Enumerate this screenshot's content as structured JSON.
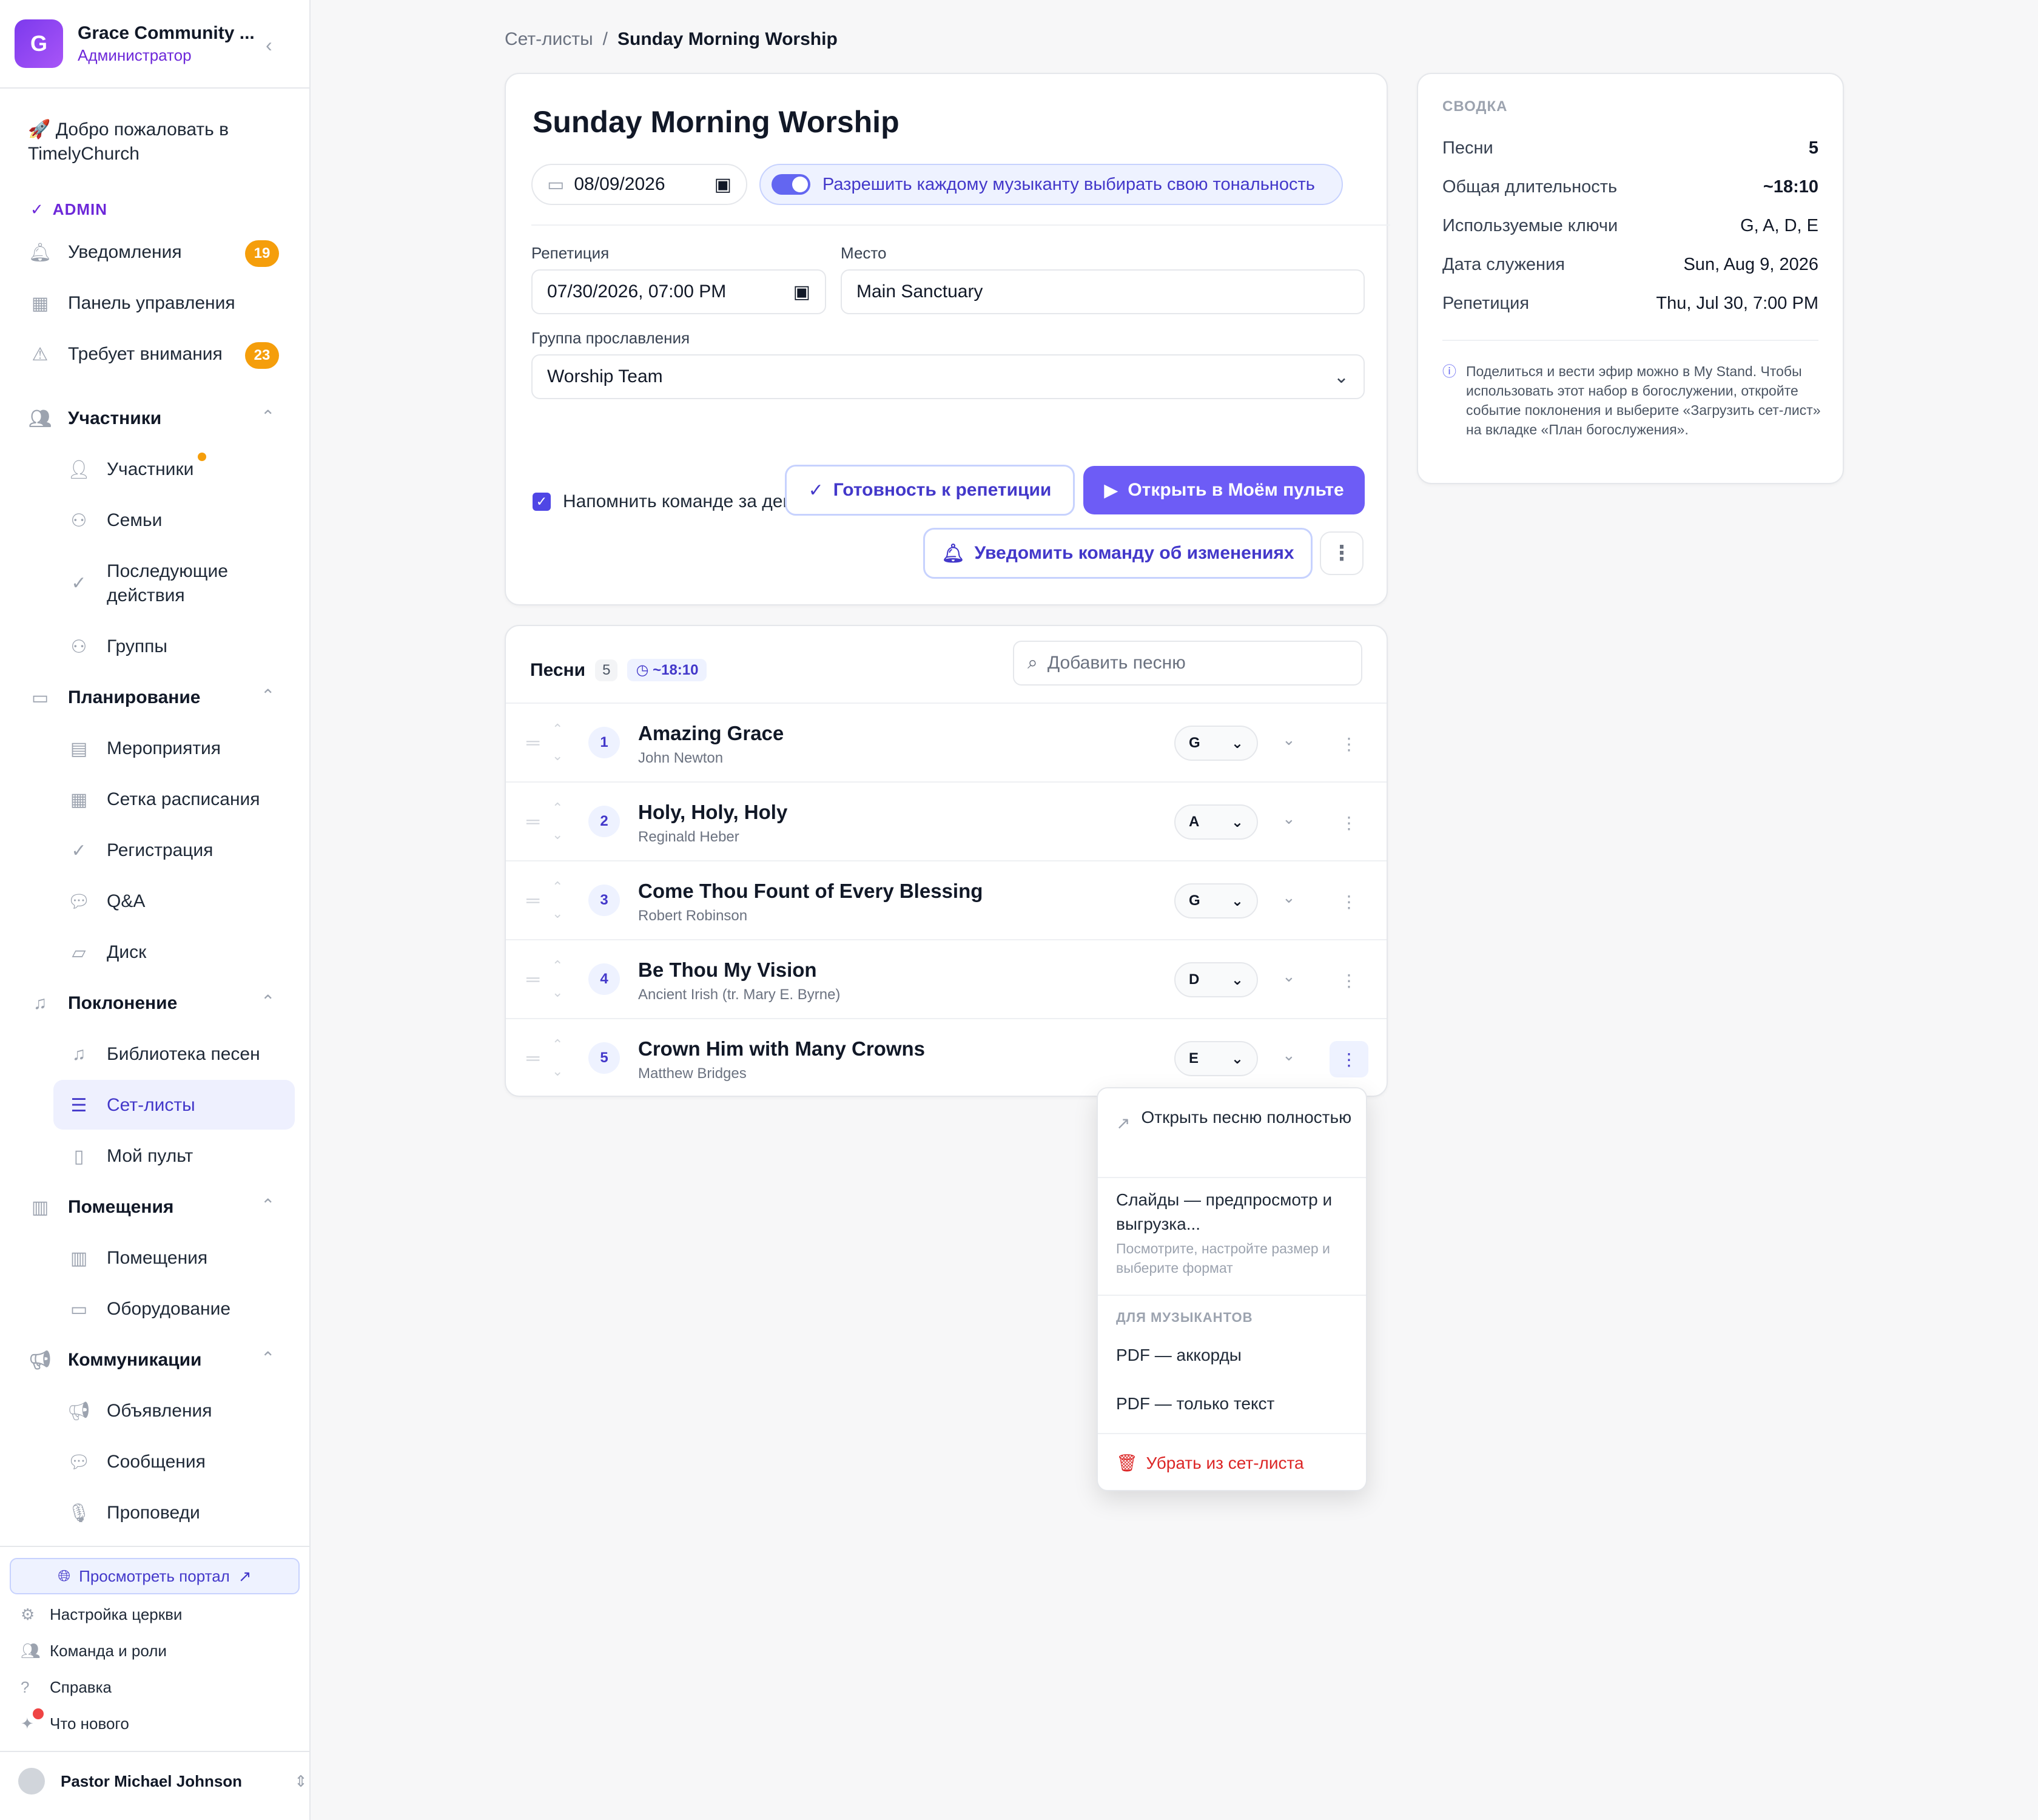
{
  "sidebar": {
    "org_initial": "G",
    "org_name": "Grace Community ...",
    "org_role": "Администратор",
    "welcome": "🚀 Добро пожаловать в TimelyChurch",
    "admin_label": "ADMIN",
    "top_items": [
      {
        "label": "Уведомления",
        "badge": "19"
      },
      {
        "label": "Панель управления"
      },
      {
        "label": "Требует внимания",
        "badge": "23"
      }
    ],
    "sections": {
      "members": {
        "label": "Участники",
        "items": [
          "Участники",
          "Семьи",
          "Последующие действия",
          "Группы"
        ]
      },
      "planning": {
        "label": "Планирование",
        "items": [
          "Мероприятия",
          "Сетка расписания",
          "Регистрация",
          "Q&A",
          "Диск"
        ]
      },
      "worship": {
        "label": "Поклонение",
        "items": [
          "Библиотека песен",
          "Сет-листы",
          "Мой пульт"
        ]
      },
      "rooms": {
        "label": "Помещения",
        "items": [
          "Помещения",
          "Оборудование"
        ]
      },
      "comms": {
        "label": "Коммуникации",
        "items": [
          "Объявления",
          "Сообщения",
          "Проповеди"
        ]
      }
    },
    "portal_button": "Просмотреть портал",
    "footer": [
      "Настройка церкви",
      "Команда и роли",
      "Справка",
      "Что нового"
    ],
    "user_name": "Pastor Michael Johnson"
  },
  "breadcrumb": {
    "parent": "Сет-листы",
    "separator": "/",
    "current": "Sunday Morning Worship"
  },
  "event": {
    "title": "Sunday Morning Worship",
    "date": "08/09/2026",
    "toggle_label": "Разрешить каждому музыканту выбирать свою тональность",
    "rehearsal_label": "Репетиция",
    "rehearsal_value": "07/30/2026, 07:00 PM",
    "location_label": "Место",
    "location_value": "Main Sanctuary",
    "team_label": "Группа прославления",
    "team_value": "Worship Team",
    "remind_label": "Напомнить команде за день до",
    "btn_readiness": "Готовность к репетиции",
    "btn_open_stand": "Открыть в Моём пульте",
    "btn_notify": "Уведомить команду об изменениях"
  },
  "songs": {
    "header": "Песни",
    "count": "5",
    "duration": "~18:10",
    "search_placeholder": "Добавить песню",
    "list": [
      {
        "n": "1",
        "title": "Amazing Grace",
        "author": "John Newton",
        "key": "G"
      },
      {
        "n": "2",
        "title": "Holy, Holy, Holy",
        "author": "Reginald Heber",
        "key": "A"
      },
      {
        "n": "3",
        "title": "Come Thou Fount of Every Blessing",
        "author": "Robert Robinson",
        "key": "G"
      },
      {
        "n": "4",
        "title": "Be Thou My Vision",
        "author": "Ancient Irish (tr. Mary E. Byrne)",
        "key": "D"
      },
      {
        "n": "5",
        "title": "Crown Him with Many Crowns",
        "author": "Matthew Bridges",
        "key": "E"
      }
    ]
  },
  "summary": {
    "header": "СВОДКА",
    "rows": [
      {
        "label": "Песни",
        "value": "5"
      },
      {
        "label": "Общая длительность",
        "value": "~18:10"
      },
      {
        "label": "Используемые ключи",
        "value": "G, A, D, E"
      },
      {
        "label": "Дата служения",
        "value": "Sun, Aug 9, 2026"
      },
      {
        "label": "Репетиция",
        "value": "Thu, Jul 30, 7:00 PM"
      }
    ],
    "note": "Поделиться и вести эфир можно в My Stand. Чтобы использовать этот набор в богослужении, откройте событие поклонения и выберите «Загрузить сет-лист» на вкладке «План богослужения»."
  },
  "context_menu": {
    "open_full": "Открыть песню полностью",
    "slides": "Слайды — предпросмотр и выгрузка...",
    "slides_sub": "Посмотрите, настройте размер и выберите формат",
    "musicians_header": "ДЛЯ МУЗЫКАНТОВ",
    "pdf_chords": "PDF — аккорды",
    "pdf_text": "PDF — только текст",
    "remove": "Убрать из сет-листа"
  },
  "colors": {
    "accent": "#6d5cf6",
    "badge": "#f59e0b",
    "danger": "#dc2626"
  },
  "icons": [
    "bell-icon",
    "grid-icon",
    "warning-icon",
    "users-icon",
    "calendar-icon",
    "music-icon",
    "list-icon",
    "book-icon",
    "building-icon",
    "megaphone-icon",
    "chat-icon",
    "mic-icon",
    "globe-icon",
    "gear-icon",
    "help-icon",
    "sparkle-icon",
    "search-icon",
    "clock-icon",
    "trash-icon",
    "external-link-icon"
  ]
}
